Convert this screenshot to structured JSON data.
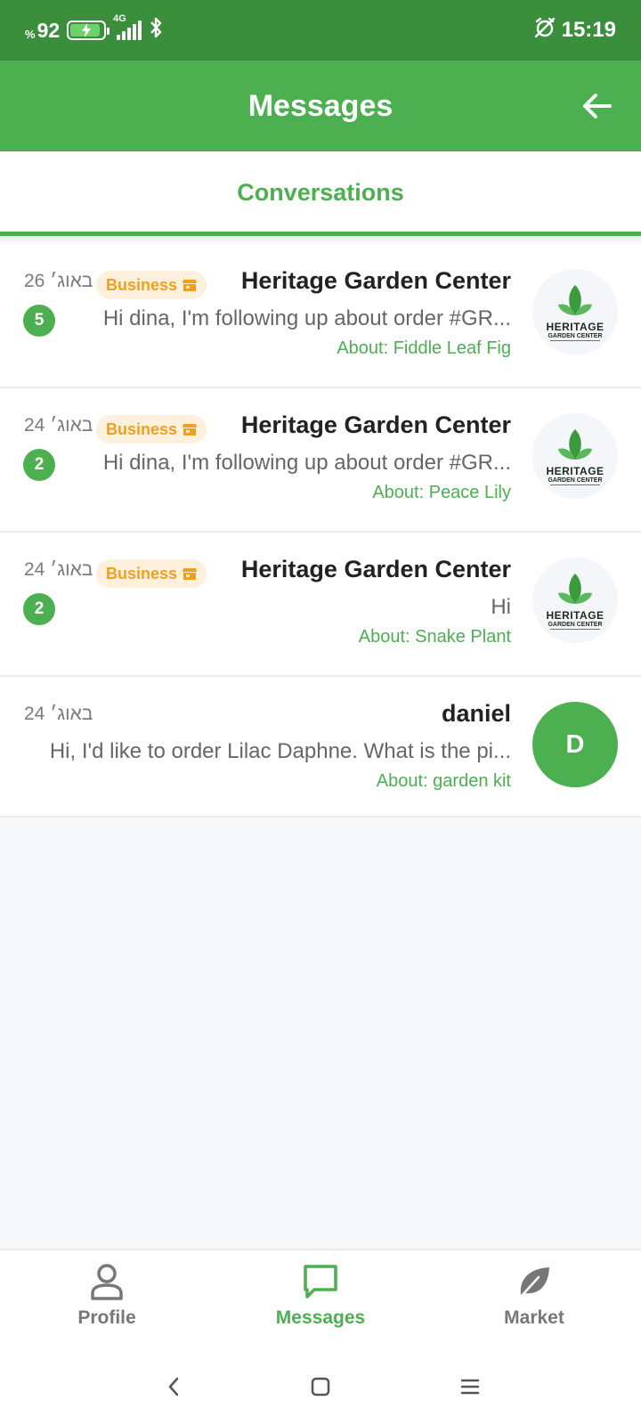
{
  "status_bar": {
    "battery_percent": "92",
    "percent_sign": "%",
    "network": "4G",
    "time": "15:19"
  },
  "header": {
    "title": "Messages",
    "back_icon": "arrow-right-icon"
  },
  "tabs": {
    "active": "Conversations"
  },
  "conversations": [
    {
      "name": "Heritage Garden Center",
      "date": "26 באוג׳",
      "badge": "Business",
      "unread": "5",
      "preview": "Hi dina, I'm following up about order #GR...",
      "about": "About: Fiddle Leaf Fig",
      "avatar": {
        "type": "logo",
        "line1": "HERITAGE",
        "line2": "GARDEN CENTER"
      }
    },
    {
      "name": "Heritage Garden Center",
      "date": "24 באוג׳",
      "badge": "Business",
      "unread": "2",
      "preview": "Hi dina, I'm following up about order #GR...",
      "about": "About: Peace Lily",
      "avatar": {
        "type": "logo",
        "line1": "HERITAGE",
        "line2": "GARDEN CENTER"
      }
    },
    {
      "name": "Heritage Garden Center",
      "date": "24 באוג׳",
      "badge": "Business",
      "unread": "2",
      "preview": "Hi",
      "about": "About: Snake Plant",
      "avatar": {
        "type": "logo",
        "line1": "HERITAGE",
        "line2": "GARDEN CENTER"
      }
    },
    {
      "name": "daniel",
      "date": "24 באוג׳",
      "preview": "Hi, I'd like to order Lilac Daphne. What is the pi...",
      "about": "About: garden kit",
      "avatar": {
        "type": "initial",
        "initial": "D"
      }
    }
  ],
  "bottom_nav": {
    "items": [
      {
        "label": "Profile",
        "icon": "person-icon"
      },
      {
        "label": "Messages",
        "icon": "chat-bubble-icon"
      },
      {
        "label": "Market",
        "icon": "leaf-icon"
      }
    ]
  },
  "colors": {
    "primary": "#4caf50",
    "status_bar": "#3a8e3c",
    "badge_bg": "#fdf0dc",
    "badge_text": "#f0a020"
  }
}
